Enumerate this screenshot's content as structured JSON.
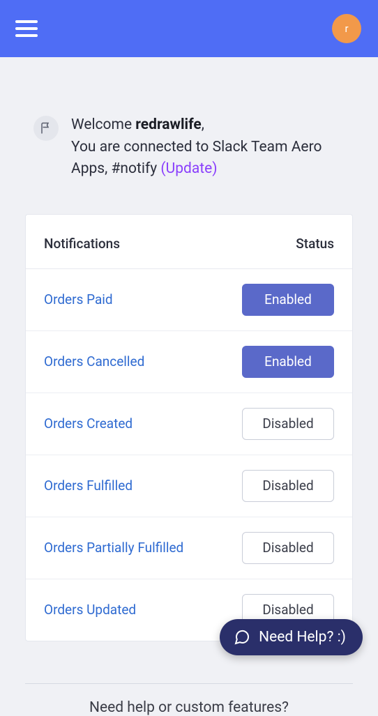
{
  "header": {
    "avatar_letter": "r"
  },
  "welcome": {
    "prefix": "Welcome ",
    "username": "redrawlife",
    "suffix": ",",
    "line2_a": "You are connected to Slack Team Aero Apps, #notify ",
    "update_label": "(Update)"
  },
  "table": {
    "col_notifications": "Notifications",
    "col_status": "Status",
    "rows": [
      {
        "label": "Orders Paid",
        "status": "Enabled",
        "enabled": true
      },
      {
        "label": "Orders Cancelled",
        "status": "Enabled",
        "enabled": true
      },
      {
        "label": "Orders Created",
        "status": "Disabled",
        "enabled": false
      },
      {
        "label": "Orders Fulfilled",
        "status": "Disabled",
        "enabled": false
      },
      {
        "label": "Orders Partially Fulfilled",
        "status": "Disabled",
        "enabled": false
      },
      {
        "label": "Orders Updated",
        "status": "Disabled",
        "enabled": false
      }
    ]
  },
  "footer": {
    "help_text": "Need help or custom features?",
    "pill_label": "Need Help? :)"
  }
}
